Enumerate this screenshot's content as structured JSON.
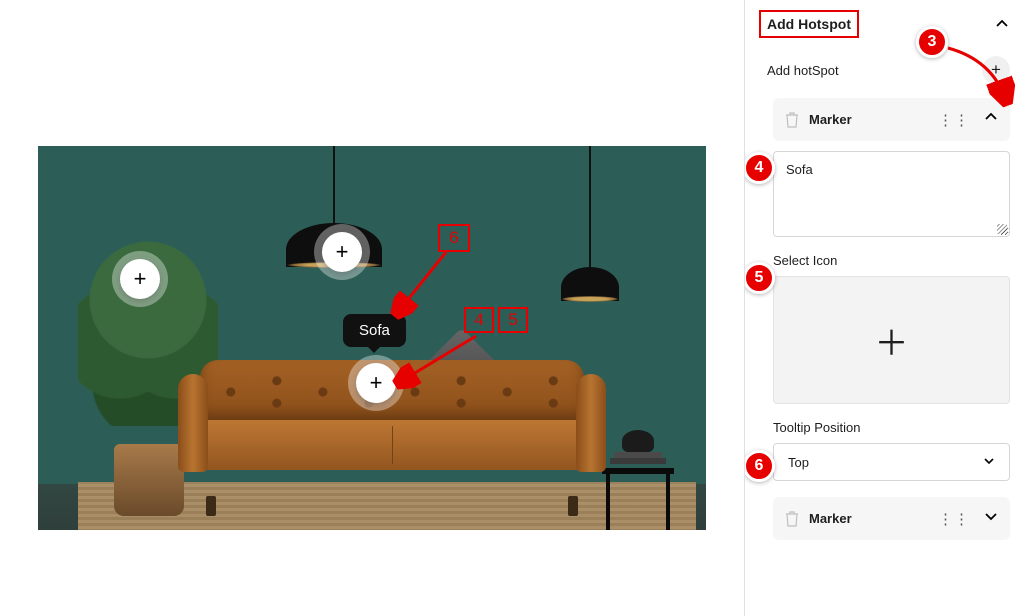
{
  "panel_header": "Add Hotspot",
  "add_hotspot_label": "Add hotSpot",
  "markers": [
    {
      "label": "Marker",
      "expanded": true
    },
    {
      "label": "Marker",
      "expanded": false
    }
  ],
  "fields": {
    "name_value": "Sofa",
    "select_icon_label": "Select Icon",
    "tooltip_position_label": "Tooltip Position",
    "tooltip_position_value": "Top"
  },
  "tooltip_text": "Sofa",
  "annotations": {
    "step3": "3",
    "step4": "4",
    "step4_inline": "4",
    "step5": "5",
    "step5_inline": "5",
    "step6": "6",
    "step6_inline": "6"
  }
}
